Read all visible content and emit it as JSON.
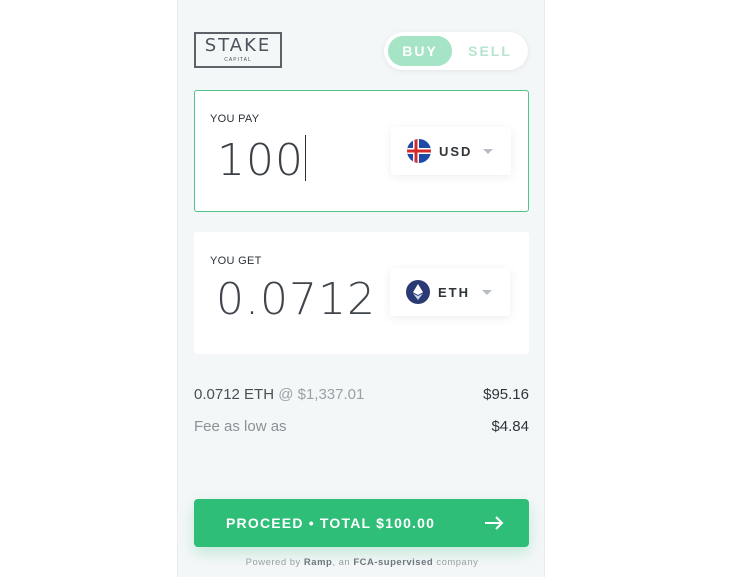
{
  "logo": {
    "main": "STAKE",
    "sub": "CAPITAL"
  },
  "toggle": {
    "buy_label": "BUY",
    "sell_label": "SELL"
  },
  "pay": {
    "label": "YOU PAY",
    "amount": "100",
    "currency": "USD",
    "flag_icon": "usd-flag-icon"
  },
  "get": {
    "label": "YOU GET",
    "amount": "0.0712",
    "currency": "ETH",
    "coin_icon": "eth-icon"
  },
  "summary": {
    "rate_amount": "0.0712 ETH",
    "rate_at": "@ $1,337.01",
    "rate_value": "$95.16",
    "fee_label": "Fee as low as",
    "fee_value": "$4.84"
  },
  "proceed": {
    "label": "PROCEED • TOTAL $100.00"
  },
  "footer": {
    "prefix": "Powered by ",
    "brand": "Ramp",
    "middle": ", an ",
    "fca": "FCA-supervised",
    "suffix": " company"
  },
  "colors": {
    "accent": "#2ebe78",
    "buy_bg": "#a5e4c4",
    "pay_border": "#4fc38a"
  }
}
